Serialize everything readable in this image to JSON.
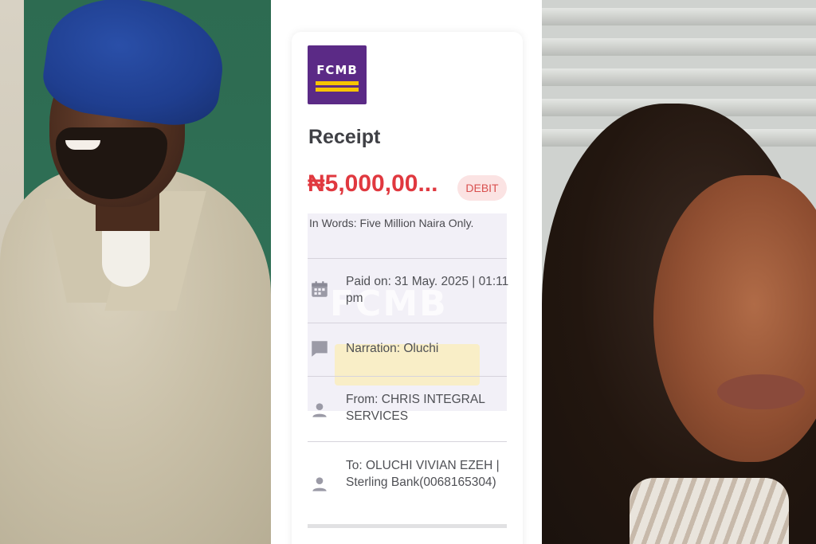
{
  "receipt": {
    "bank_logo_text": "FCMB",
    "title": "Receipt",
    "amount": "₦5,000,00...",
    "type_badge": "DEBIT",
    "in_words": "In Words: Five Million Naira  Only.",
    "watermark": "FCMB",
    "rows": [
      {
        "icon": "calendar-icon",
        "text": "Paid on: 31 May. 2025 | 01:11 pm"
      },
      {
        "icon": "chat-icon",
        "text": "Narration: Oluchi"
      },
      {
        "icon": "user-icon",
        "text": "From: CHRIS INTEGRAL SERVICES"
      },
      {
        "icon": "user-icon",
        "text": "To: OLUCHI VIVIAN EZEH | Sterling Bank(0068165304)"
      }
    ]
  },
  "colors": {
    "brand_purple": "#5b2a86",
    "brand_yellow": "#f7c400",
    "amount_red": "#e0383f",
    "badge_bg": "#fbe3e3",
    "row_bg": "#f2f0f7"
  }
}
